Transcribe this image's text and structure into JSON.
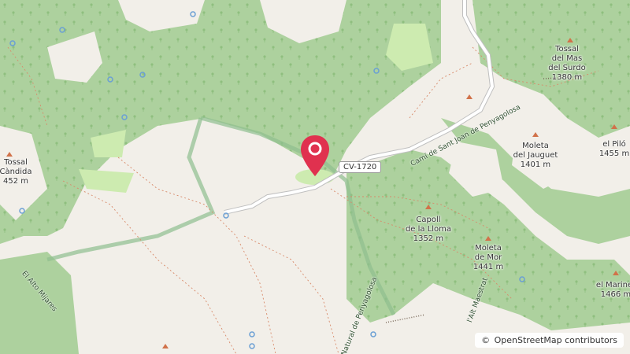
{
  "map": {
    "attribution": {
      "symbol": "©",
      "text": "OpenStreetMap contributors"
    },
    "road_shield": "CV-1720",
    "road_name": "Camí de Sant Joan de Penyagolosa",
    "peaks": [
      {
        "name": "Tossal",
        "name2": "del Mas",
        "name3": "del Surdo",
        "elev": "1380 m"
      },
      {
        "name": "Moleta",
        "name2": "del Jauguet",
        "elev": "1401 m"
      },
      {
        "name": "el Piló",
        "elev": "1455 m"
      },
      {
        "name": "Capoll",
        "name2": "de la Lloma",
        "elev": "1352 m"
      },
      {
        "name": "Moleta",
        "name2": "de Mor",
        "elev": "1441 m"
      },
      {
        "name": "el Marinet",
        "elev": "1466 m"
      },
      {
        "name": "Tossal",
        "name2": "Càndida",
        "elev": "452 m"
      }
    ],
    "trail_labels": {
      "alto_mijares": "El Alto Mijares",
      "alt_maestrat": "l'Alt Maestrat",
      "parc_natural": "Natural de Penyagolosa"
    },
    "colors": {
      "forest": "#add19e",
      "land": "#f2efe9",
      "pin": "#e0314f",
      "park_border": "#8fbf8f"
    },
    "marker_icon": "map-pin-icon"
  }
}
